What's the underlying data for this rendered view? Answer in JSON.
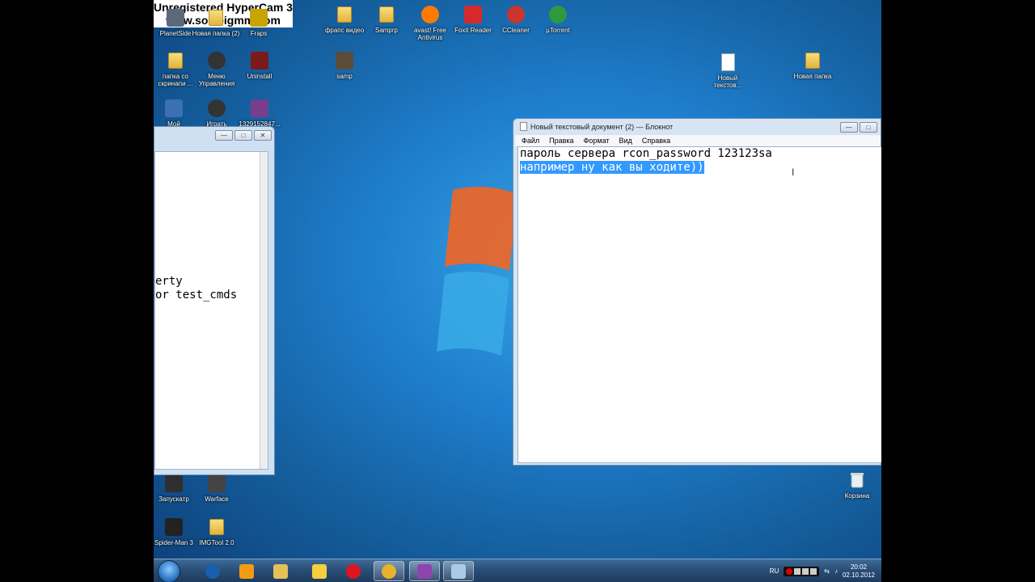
{
  "watermark": {
    "line1": "Unregistered HyperCam 3",
    "line2": "www.solveigmm.com"
  },
  "desktop_icons": [
    {
      "label": "PlanetSide",
      "kind": "app",
      "color": "#5a6a7a"
    },
    {
      "label": "Новая папка (2)",
      "kind": "folder"
    },
    {
      "label": "Fraps",
      "kind": "app",
      "color": "#c8a400"
    },
    {
      "label": "фрапс видео",
      "kind": "folder"
    },
    {
      "label": "Samprp",
      "kind": "folder"
    },
    {
      "label": "avast! Free Antivirus",
      "kind": "app",
      "color": "#ff7a00"
    },
    {
      "label": "Foxit Reader",
      "kind": "app",
      "color": "#d6292b"
    },
    {
      "label": "CCleaner",
      "kind": "app",
      "color": "#c8362d"
    },
    {
      "label": "µTorrent",
      "kind": "app",
      "color": "#2e9a3d"
    },
    {
      "label": "папка со скринапи ...",
      "kind": "folder"
    },
    {
      "label": "Меню Управления",
      "kind": "app",
      "color": "#333333"
    },
    {
      "label": "Uninstall",
      "kind": "app",
      "color": "#7a1a1a"
    },
    {
      "label": "samp",
      "kind": "app",
      "color": "#5b4c3a"
    },
    {
      "label": "Новый текстов...",
      "kind": "doc"
    },
    {
      "label": "Новая папка",
      "kind": "folder"
    },
    {
      "label": "Мой",
      "kind": "app",
      "color": "#3b6fb6"
    },
    {
      "label": "Играть",
      "kind": "app",
      "color": "#333333"
    },
    {
      "label": "1329152847...",
      "kind": "app",
      "color": "#7a3d8c"
    },
    {
      "label": "Запускатр",
      "kind": "app",
      "color": "#2f2f2f"
    },
    {
      "label": "Warface",
      "kind": "app",
      "color": "#444444"
    },
    {
      "label": "Spider-Man 3",
      "kind": "app",
      "color": "#222222"
    },
    {
      "label": "IMGTool 2.0",
      "kind": "folder"
    },
    {
      "label": "Корзина",
      "kind": "trash"
    }
  ],
  "left_window": {
    "line1": "erty",
    "line2": "or test_cmds"
  },
  "notepad": {
    "title": "Новый текстовый документ (2) — Блокнот",
    "menu": [
      "Файл",
      "Правка",
      "Формат",
      "Вид",
      "Справка"
    ],
    "line1": "пароль сервера rcon_password 123123sa",
    "line2_selected": "например ну как вы ходите))"
  },
  "taskbar": {
    "pinned": [
      {
        "name": "opera-alt-icon",
        "color": "#1a5fae"
      },
      {
        "name": "media-player-icon",
        "color": "#f39c12"
      },
      {
        "name": "explorer-icon",
        "color": "#e5c158"
      },
      {
        "name": "game-icon",
        "color": "#f4d03f"
      },
      {
        "name": "opera-icon",
        "color": "#e0141e"
      },
      {
        "name": "chrome-icon",
        "color": "#e8b22d"
      },
      {
        "name": "winrar-icon",
        "color": "#8e44ad"
      },
      {
        "name": "notepad-icon",
        "color": "#a9cbe8"
      }
    ],
    "lang": "RU",
    "time": "20:02",
    "date": "02.10.2012"
  }
}
